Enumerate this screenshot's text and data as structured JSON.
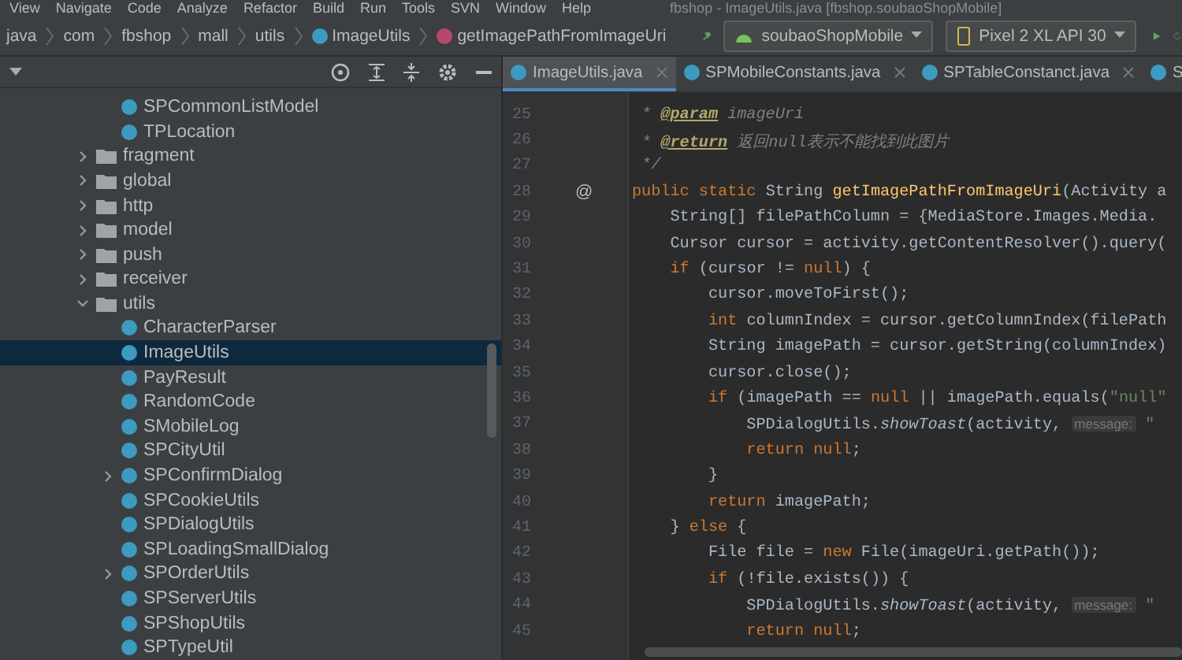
{
  "menu_bar": {
    "items": [
      "View",
      "Navigate",
      "Code",
      "Analyze",
      "Refactor",
      "Build",
      "Run",
      "Tools",
      "SVN",
      "Window",
      "Help"
    ],
    "title": "fbshop - ImageUtils.java [fbshop.soubaoShopMobile]"
  },
  "breadcrumb": [
    {
      "kind": "plain",
      "label": "java"
    },
    {
      "kind": "plain",
      "label": "com"
    },
    {
      "kind": "plain",
      "label": "fbshop"
    },
    {
      "kind": "plain",
      "label": "mall"
    },
    {
      "kind": "plain",
      "label": "utils"
    },
    {
      "kind": "class",
      "label": "ImageUtils"
    },
    {
      "kind": "method",
      "label": "getImagePathFromImageUri"
    }
  ],
  "run_config": {
    "label": "soubaoShopMobile"
  },
  "device": {
    "label": "Pixel 2 XL API 30"
  },
  "project_tree": {
    "leading_children": [
      {
        "label": "SPCommonListModel",
        "selected": false
      },
      {
        "label": "TPLocation",
        "selected": false
      }
    ],
    "items": [
      {
        "label": "fragment",
        "expanded": false
      },
      {
        "label": "global",
        "expanded": false
      },
      {
        "label": "http",
        "expanded": false
      },
      {
        "label": "model",
        "expanded": false
      },
      {
        "label": "push",
        "expanded": false
      },
      {
        "label": "receiver",
        "expanded": false
      },
      {
        "label": "utils",
        "expanded": true,
        "children": [
          {
            "label": "CharacterParser",
            "selected": false,
            "expandable": false
          },
          {
            "label": "ImageUtils",
            "selected": true,
            "expandable": false
          },
          {
            "label": "PayResult",
            "selected": false,
            "expandable": false
          },
          {
            "label": "RandomCode",
            "selected": false,
            "expandable": false
          },
          {
            "label": "SMobileLog",
            "selected": false,
            "expandable": false
          },
          {
            "label": "SPCityUtil",
            "selected": false,
            "expandable": false
          },
          {
            "label": "SPConfirmDialog",
            "selected": false,
            "expandable": true
          },
          {
            "label": "SPCookieUtils",
            "selected": false,
            "expandable": false
          },
          {
            "label": "SPDialogUtils",
            "selected": false,
            "expandable": false
          },
          {
            "label": "SPLoadingSmallDialog",
            "selected": false,
            "expandable": false
          },
          {
            "label": "SPOrderUtils",
            "selected": false,
            "expandable": true
          },
          {
            "label": "SPServerUtils",
            "selected": false,
            "expandable": false
          },
          {
            "label": "SPShopUtils",
            "selected": false,
            "expandable": false
          },
          {
            "label": "SPTypeUtil",
            "selected": false,
            "expandable": false
          }
        ]
      }
    ]
  },
  "editor_tabs": [
    {
      "label": "ImageUtils.java",
      "selected": true
    },
    {
      "label": "SPMobileConstants.java",
      "selected": false
    },
    {
      "label": "SPTableConstanct.java",
      "selected": false
    },
    {
      "label": "S",
      "selected": false
    }
  ],
  "code_lines": [
    {
      "number": "25",
      "tokens": [
        {
          "kind": "comment",
          "text": " * "
        },
        {
          "kind": "doctag",
          "text": "@param"
        },
        {
          "kind": "comment",
          "text": " imageUri"
        }
      ]
    },
    {
      "number": "26",
      "tokens": [
        {
          "kind": "comment",
          "text": " * "
        },
        {
          "kind": "doctag",
          "text": "@return"
        },
        {
          "kind": "comment",
          "text": " 返回null表示不能找到此图片"
        }
      ]
    },
    {
      "number": "27",
      "tokens": [
        {
          "kind": "comment",
          "text": " */"
        }
      ]
    },
    {
      "number": "28",
      "gutter": "@",
      "tokens": [
        {
          "kind": "keyword",
          "text": "public static "
        },
        {
          "kind": "plain",
          "text": "String "
        },
        {
          "kind": "declaration",
          "text": "getImagePathFromImageUri"
        },
        {
          "kind": "plain",
          "text": "(Activity a"
        }
      ]
    },
    {
      "number": "29",
      "tokens": [
        {
          "kind": "plain",
          "text": "    String[] filePathColumn = {MediaStore.Images.Media."
        }
      ]
    },
    {
      "number": "30",
      "tokens": [
        {
          "kind": "plain",
          "text": "    Cursor cursor = activity.getContentResolver().query("
        }
      ]
    },
    {
      "number": "31",
      "tokens": [
        {
          "kind": "keyword",
          "text": "    if "
        },
        {
          "kind": "plain",
          "text": "(cursor != "
        },
        {
          "kind": "keyword",
          "text": "null"
        },
        {
          "kind": "plain",
          "text": ") {"
        }
      ]
    },
    {
      "number": "32",
      "tokens": [
        {
          "kind": "plain",
          "text": "        cursor.moveToFirst();"
        }
      ]
    },
    {
      "number": "33",
      "tokens": [
        {
          "kind": "keyword",
          "text": "        int "
        },
        {
          "kind": "plain",
          "text": "columnIndex = cursor.getColumnIndex(filePath"
        }
      ]
    },
    {
      "number": "34",
      "tokens": [
        {
          "kind": "plain",
          "text": "        String imagePath = cursor.getString(columnIndex)"
        }
      ]
    },
    {
      "number": "35",
      "tokens": [
        {
          "kind": "plain",
          "text": "        cursor.close();"
        }
      ]
    },
    {
      "number": "36",
      "tokens": [
        {
          "kind": "keyword",
          "text": "        if "
        },
        {
          "kind": "plain",
          "text": "(imagePath == "
        },
        {
          "kind": "keyword",
          "text": "null "
        },
        {
          "kind": "plain",
          "text": "|| imagePath.equals("
        },
        {
          "kind": "string",
          "text": "\"null\""
        }
      ]
    },
    {
      "number": "37",
      "tokens": [
        {
          "kind": "plain",
          "text": "            SPDialogUtils."
        },
        {
          "kind": "static",
          "text": "showToast"
        },
        {
          "kind": "plain",
          "text": "(activity, "
        },
        {
          "kind": "hint",
          "text": "message:"
        },
        {
          "kind": "string",
          "text": " \""
        }
      ]
    },
    {
      "number": "38",
      "tokens": [
        {
          "kind": "keyword",
          "text": "            return null"
        },
        {
          "kind": "plain",
          "text": ";"
        }
      ]
    },
    {
      "number": "39",
      "tokens": [
        {
          "kind": "plain",
          "text": "        }"
        }
      ]
    },
    {
      "number": "40",
      "tokens": [
        {
          "kind": "keyword",
          "text": "        return "
        },
        {
          "kind": "plain",
          "text": "imagePath;"
        }
      ]
    },
    {
      "number": "41",
      "tokens": [
        {
          "kind": "plain",
          "text": "    } "
        },
        {
          "kind": "keyword",
          "text": "else "
        },
        {
          "kind": "plain",
          "text": "{"
        }
      ]
    },
    {
      "number": "42",
      "tokens": [
        {
          "kind": "plain",
          "text": "        File file = "
        },
        {
          "kind": "keyword",
          "text": "new "
        },
        {
          "kind": "plain",
          "text": "File(imageUri.getPath());"
        }
      ]
    },
    {
      "number": "43",
      "tokens": [
        {
          "kind": "keyword",
          "text": "        if "
        },
        {
          "kind": "plain",
          "text": "(!file.exists()) {"
        }
      ]
    },
    {
      "number": "44",
      "tokens": [
        {
          "kind": "plain",
          "text": "            SPDialogUtils."
        },
        {
          "kind": "static",
          "text": "showToast"
        },
        {
          "kind": "plain",
          "text": "(activity, "
        },
        {
          "kind": "hint",
          "text": "message:"
        },
        {
          "kind": "string",
          "text": " \""
        }
      ]
    },
    {
      "number": "45",
      "tokens": [
        {
          "kind": "keyword",
          "text": "            return null"
        },
        {
          "kind": "plain",
          "text": ";"
        }
      ]
    }
  ]
}
